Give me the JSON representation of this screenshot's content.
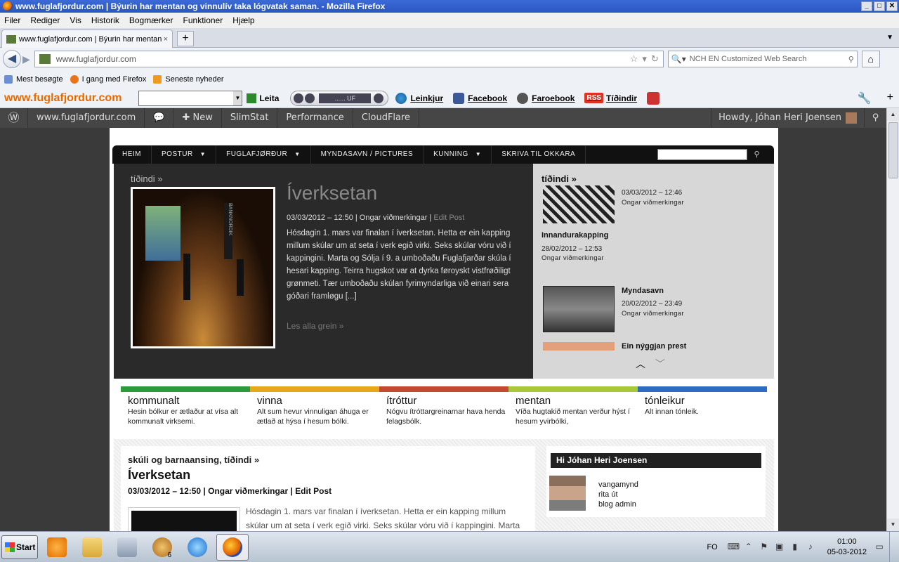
{
  "browser": {
    "window_title": "www.fuglafjordur.com | Býurin har mentan og vinnulív taka lógvatak saman. - Mozilla Firefox",
    "window_buttons": [
      "_",
      "□",
      "✕"
    ],
    "menu": [
      "Filer",
      "Rediger",
      "Vis",
      "Historik",
      "Bogmærker",
      "Funktioner",
      "Hjælp"
    ],
    "tab_label": "www.fuglafjordur.com | Býurin har mentan ...",
    "tab_close": "×",
    "new_tab": "+",
    "url": "www.fuglafjordur.com",
    "search_placeholder": "NCH EN Customized Web Search",
    "bookmarks": [
      "Mest besøgte",
      "I gang med Firefox",
      "Seneste nyheder"
    ]
  },
  "addon_toolbar": {
    "brand": "www.fuglafjordur.com",
    "search_button": "Leita",
    "player_label": "...... UF",
    "links": [
      "Leinkjur",
      "Facebook",
      "Faroebook",
      "Tíðindir"
    ],
    "rss_badge": "RSS"
  },
  "wp_admin_bar": {
    "site": "www.fuglafjordur.com",
    "new": "New",
    "items": [
      "SlimStat",
      "Performance",
      "CloudFlare"
    ],
    "howdy": "Howdy, Jóhan Heri Joensen"
  },
  "site": {
    "nav": [
      "HEIM",
      "POSTUR",
      "FUGLAFJØRÐUR",
      "MYNDASAVN / PICTURES",
      "KUNNING",
      "SKRIVA TIL OKKARA"
    ],
    "featured": {
      "section": "tíðindi »",
      "title": "Íverksetan",
      "meta": "03/03/2012 – 12:50 | Ongar viðmerkingar | ",
      "edit": "Edit Post",
      "body": "Hósdagin 1. mars var finalan í íverksetan. Hetta er ein kapping millum skúlar um at seta í verk egið virki. Seks skúlar vóru við í kappingini. Marta og Sólja í 9. a umboðaðu Fuglafjarðar skúla í hesari kapping. Teirra hugskot var at dyrka føroyskt vistfrøðiligt grønmeti. Tær umboðaðu skúlan fyrimyndarliga við einari sera góðari framløgu [...]",
      "more": "Les alla grein »",
      "banner_text": "BANKNORDIK"
    },
    "side_news": {
      "section": "tíðindi »",
      "items": [
        {
          "title": "",
          "date": "03/03/2012 – 12:46",
          "comments": "Ongar viðmerkingar"
        },
        {
          "title": "Innandurakapping",
          "date": "28/02/2012 – 12:53",
          "comments": "Ongar viðmerkingar"
        },
        {
          "title": "Myndasavn",
          "date": "20/02/2012 – 23:49",
          "comments": "Ongar viðmerkingar"
        },
        {
          "title": "Ein nýggjan prest",
          "date": "",
          "comments": ""
        }
      ]
    },
    "categories": [
      {
        "name": "kommunalt",
        "desc": "Hesin bólkur er ætlaður at vísa alt kommunalt virksemi.",
        "color": "#2e9a3a"
      },
      {
        "name": "vinna",
        "desc": "Alt sum hevur vinnuligan áhuga er ætlað at hýsa í hesum bólki.",
        "color": "#e5a81a"
      },
      {
        "name": "ítróttur",
        "desc": "Nógvu ítróttargreinarnar hava henda felagsbólk.",
        "color": "#c24a2e"
      },
      {
        "name": "mentan",
        "desc": "Víða hugtakið mentan verður hýst í hesum yvirbólki,",
        "color": "#a8c83a"
      },
      {
        "name": "tónleikur",
        "desc": "Alt innan tónleik.",
        "color": "#2f6cc0"
      }
    ],
    "post": {
      "category": "skúli og barnaansing, tíðindi »",
      "title": "Íverksetan",
      "meta": "03/03/2012 – 12:50 | Ongar viðmerkingar | Edit Post",
      "body": "Hósdagin 1. mars var finalan í íverksetan. Hetta er ein kapping millum skúlar um at seta í verk egið virki. Seks skúlar vóru við í kappingini. Marta"
    },
    "user_box": {
      "title": "Hi Jóhan Heri Joensen",
      "links": [
        "vangamynd",
        "rita út",
        "blog admin"
      ]
    }
  },
  "taskbar": {
    "start": "Start",
    "badge": "6",
    "lang": "FO",
    "time": "01:00",
    "date": "05-03-2012"
  }
}
